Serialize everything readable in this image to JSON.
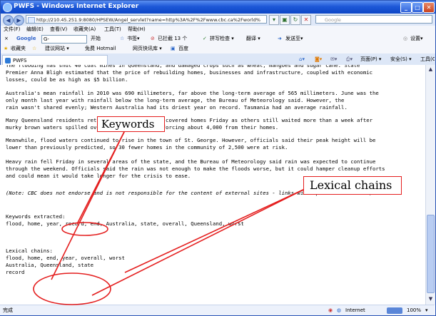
{
  "window": {
    "title": "PWFS - Windows Internet Explorer"
  },
  "nav": {
    "address": "http://210.45.251.9:8080/HPSEW/Angel_servlet?name=http%3A%2F%2Fwww.cbc.ca%2Fworld%",
    "search_placeholder": "Google"
  },
  "menu": [
    "文件(F)",
    "编辑(E)",
    "查看(V)",
    "收藏夹(A)",
    "工具(T)",
    "帮助(H)"
  ],
  "google_toolbar": {
    "close": "×",
    "brand": "Google",
    "search_box": "G-",
    "start": "开始",
    "bookmarks": "书签▾",
    "blocked": "已拦截 13 个",
    "spellcheck": "拼写检查 ▾",
    "translate": "翻译 ▾",
    "send": "发送至▾",
    "settings": "设置▾"
  },
  "favorites_bar": {
    "favorites": "收藏夹",
    "suggested": "建议网站 ▾",
    "hotmail": "免费 Hotmail",
    "gallery": "网页快讯库 ▾",
    "baidu": "百度"
  },
  "tab": {
    "label": "PWFS"
  },
  "tab_tools": {
    "page": "页面(P) ▾",
    "safety": "安全(S) ▾",
    "tools": "工具(O) ▾",
    "help": "❓ ▾"
  },
  "content": {
    "p1": "The flooding has shut 40 coal mines in Queensland, and damaged crops such as wheat, mangoes and sugar cane. State\nPremier Anna Bligh estimated that the price of rebuilding homes, businesses and infrastructure, coupled with economic\nlosses, could be as high as $5 billion.",
    "p2": "Australia's mean rainfall in 2010 was 690 millimeters, far above the long-term average of 565 millimeters. June was the\nonly month last year with rainfall below the long-term average, the Bureau of Meteorology said. However, the\nrain wasn't shared evenly; Western Australia had its driest year on record. Tasmania had an average rainfall.",
    "p3": "Many Queensland residents returned to their sludge-covered homes Friday as others still waited more than a week after\nmurky brown waters spilled over their riverbanks, forcing about 4,000 from their homes.",
    "p4": "Meanwhile, flood waters continued to rise in the town of St. George. However, officials said their peak height will be\nlower than previously predicted, so 30 fewer homes in the community of 2,500 were at risk.",
    "p5": "Heavy rain fell Friday in several areas of the state, and the Bureau of Meteorology said rain was expected to continue\nthrough the weekend. Officials said the rain was not enough to make the floods worse, but it could hamper cleanup efforts\nand could mean it would take longer for the crisis to ease.",
    "note": "(Note: CBC does not endorse and is not responsible for the content of external sites - links will open in new window)",
    "keywords_label": "Keywords extracted:",
    "keywords": "flood, home, year, record, end, Australia, state, overall, Queensland, worst",
    "chains_label": "Lexical chains:",
    "chains": "flood, home, end, year, overall, worst\nAustralia, Queensland, state\nrecord"
  },
  "annotations": {
    "keywords": "Keywords",
    "lexical_chains": "Lexical chains",
    "color": "#e41e1e"
  },
  "status": {
    "left": "完成",
    "zone": "Internet",
    "zoom": "100%"
  }
}
